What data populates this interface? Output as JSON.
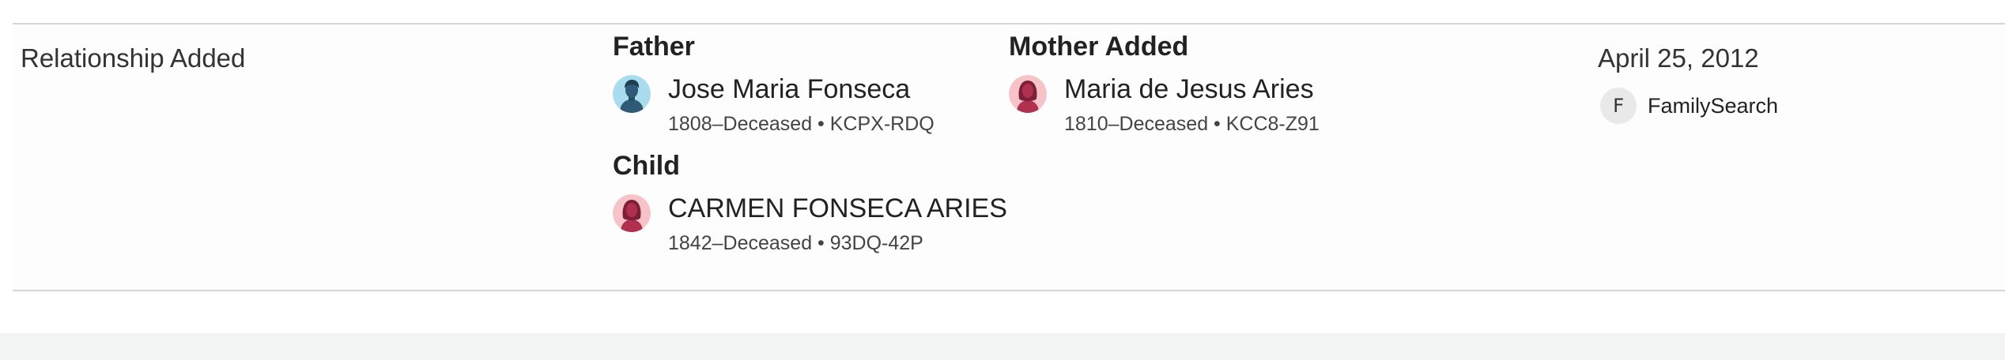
{
  "change": {
    "type_label": "Relationship Added"
  },
  "father": {
    "heading": "Father",
    "name": "Jose Maria Fonseca",
    "meta": "1808–Deceased • KCPX-RDQ",
    "avatar": "male-avatar-icon"
  },
  "mother": {
    "heading": "Mother Added",
    "name": "Maria de Jesus Aries",
    "meta": "1810–Deceased • KCC8-Z91",
    "avatar": "female-avatar-icon"
  },
  "child": {
    "heading": "Child",
    "name": "CARMEN FONSECA ARIES",
    "meta": "1842–Deceased • 93DQ-42P",
    "avatar": "female-avatar-icon"
  },
  "date": "April 25, 2012",
  "contributor": {
    "icon_letter": "F",
    "name": "FamilySearch"
  },
  "colors": {
    "male_avatar_bg": "#a9dcee",
    "male_avatar_fg": "#2f5b78",
    "female_avatar_bg": "#f6c4c8",
    "female_avatar_fg": "#b0304f",
    "divider": "#d6d6d6",
    "footer_band": "#f2f3f3"
  }
}
